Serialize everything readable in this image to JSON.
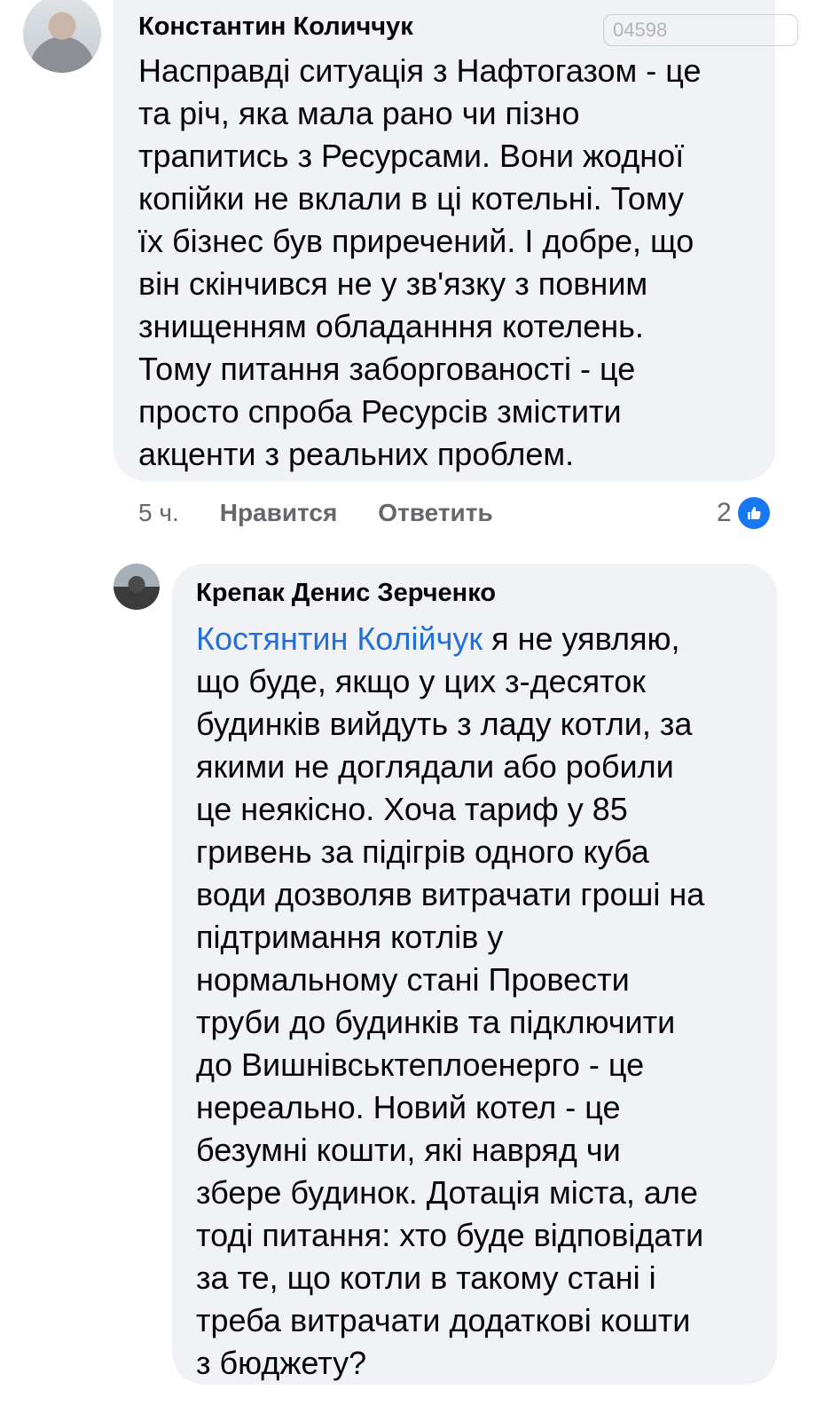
{
  "comment1": {
    "author": "Константин Количчук",
    "text": "Насправді ситуація з Нафтогазом - це\nта річ, яка мала рано чи пізно\nтрапитись з Ресурсами. Вони жодної\nкопійки не вклали в ці котельні. Тому\nїх бізнес був приречений. І добре, що\nвін скінчився не у зв'язку з повним\nзнищенням обладанння котелень.\nТому питання заборгованості - це\nпросто спроба Ресурсів змістити\nакценти з реальних проблем.",
    "time": "5 ч.",
    "like_label": "Нравится",
    "reply_label": "Ответить",
    "reaction_count": "2",
    "reaction_icon": "like-thumb-icon"
  },
  "comment2": {
    "author": "Крепак Денис Зерченко",
    "mention": "Костянтин Колійчук",
    "text": " я не уявляю,\nщо буде, якщо у цих з-десяток\nбудинків вийдуть з ладу котли, за\nякими не доглядали або робили\nце неякісно. Хоча тариф у 85\nгривень за підігрів одного куба\nводи дозволяв витрачати гроші на\nпідтримання котлів у\nнормальному стані  Провести\nтруби до будинків та підключити\nдо Вишнівськтеплоенерго - це\nнереально. Новий котел - це\nбезумні кошти, які навряд чи\nзбере будинок. Дотація міста, але\nтоді питання: хто буде відповідати\nза те, що котли в такому стані і\nтреба витрачати додаткові кошти\nз бюджету?"
  },
  "watermark": "04598",
  "colors": {
    "bubble": "#f0f2f5",
    "mention": "#216fdb",
    "meta": "#65676b",
    "like": "#1877f2"
  }
}
